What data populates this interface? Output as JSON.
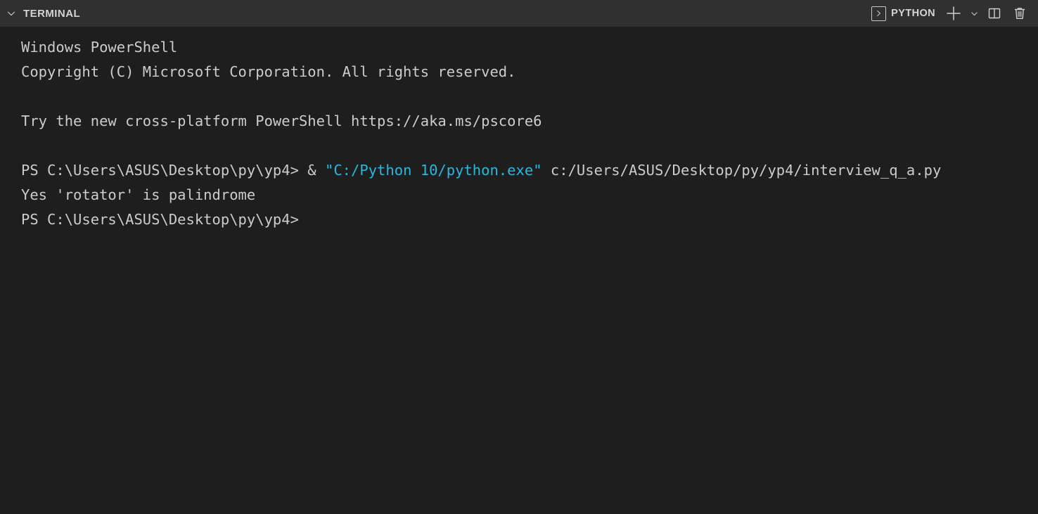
{
  "header": {
    "collapse_icon": "chevron-down-icon",
    "title": "TERMINAL",
    "tab": {
      "icon": "console-icon",
      "label": "PYTHON"
    },
    "actions": [
      {
        "name": "new-terminal-button",
        "icon": "plus-icon",
        "label": "+"
      },
      {
        "name": "terminal-profile-dropdown",
        "icon": "chevron-down-icon",
        "label": ""
      },
      {
        "name": "split-terminal-button",
        "icon": "split-panel-icon",
        "label": ""
      },
      {
        "name": "kill-terminal-button",
        "icon": "trash-icon",
        "label": ""
      }
    ]
  },
  "colors": {
    "header_bg": "#303031",
    "terminal_bg": "#1e1e1e",
    "text": "#cccccc",
    "accent_cyan": "#29b8db"
  },
  "terminal": {
    "lines": [
      {
        "id": "line-1",
        "text": "Windows PowerShell"
      },
      {
        "id": "line-2",
        "text": "Copyright (C) Microsoft Corporation. All rights reserved."
      },
      {
        "id": "line-3",
        "text": ""
      },
      {
        "id": "line-4",
        "text": "Try the new cross-platform PowerShell https://aka.ms/pscore6"
      },
      {
        "id": "line-5",
        "text": ""
      },
      {
        "id": "line-6-command",
        "prompt": "PS C:\\Users\\ASUS\\Desktop\\py\\yp4> ",
        "amp": "& ",
        "interpreter": "\"C:/Python 10/python.exe\"",
        "script": " c:/Users/ASUS/Desktop/py/yp4/interview_q_a.py"
      },
      {
        "id": "line-7-output",
        "text": "Yes 'rotator' is palindrome"
      },
      {
        "id": "line-8-prompt",
        "text": "PS C:\\Users\\ASUS\\Desktop\\py\\yp4>"
      }
    ]
  }
}
